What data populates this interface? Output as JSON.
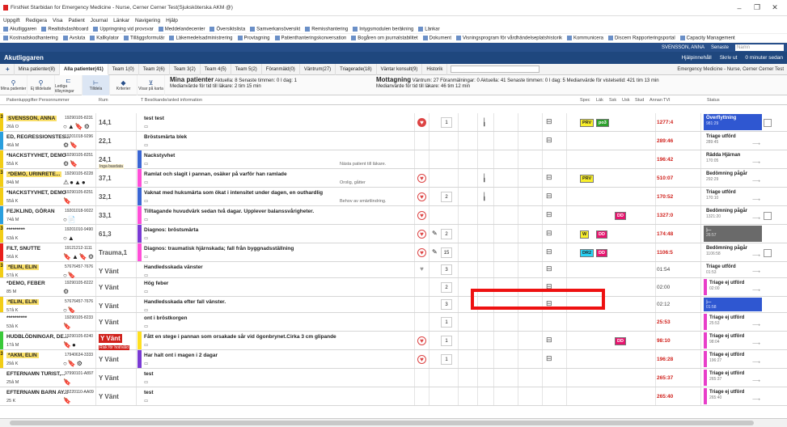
{
  "window": {
    "title": "FirstNet Starbidan for Emergency Medicine - Nurse, Cerner Cerner Test(Sjuksköterska AKM @)",
    "min": "–",
    "restore": "❐",
    "close": "✕"
  },
  "menu": [
    "Uppgift",
    "Redigera",
    "Visa",
    "Patient",
    "Journal",
    "Länkar",
    "Navigering",
    "Hjälp"
  ],
  "bookmarks1": [
    "Akutliggaren",
    "Realtidsdashboard",
    "Uppringning vid provsvar",
    "Meddelandecenter",
    "Översiktslista",
    "Samverkansöversikt",
    "Remisshantering",
    "Intygsmodulen beräkning",
    "Länkar"
  ],
  "bookmarks2": [
    "Kostnadskodhantering",
    "Avsluta",
    "Kallkylator",
    "Tilläggsformulär",
    "Läkemedelsadministrering",
    "Provtagning",
    "Patienthanteringskonversation",
    "Bogåren om journalstabilitet",
    "Dokument",
    "Visningsprogram för vårdhändelseplatshistorik",
    "Kommunicera",
    "Discern Rapporteringsportal",
    "Capacity Management"
  ],
  "userbar": {
    "user": "SVENSSON, ANNA",
    "role": "Senaste",
    "search_placeholder": "Namn"
  },
  "appbar": {
    "title": "Akutliggaren",
    "help": "Hjälpinnehåll",
    "print": "Skriv ut",
    "refresh": "0 minuter sedan"
  },
  "tabs": [
    "+",
    "Mina patienter(8)",
    "Alla patienter(41)",
    "Team 1(0)",
    "Team 2(6)",
    "Team 3(2)",
    "Team 4(5)",
    "Team 5(2)",
    "Föranmäld(0)",
    "Väntrum(27)",
    "Triagerade(18)",
    "Väntar konsult(9)",
    "Historik"
  ],
  "tabs_context": "Emergency Medicine - Nurse, Cerner Cerner Test",
  "toolbar": {
    "buttons": [
      "Mina patienter",
      "Ej tilldelade",
      "Lediga tillsyningar",
      "Tilldela",
      "Kriterier",
      "Visar på karta"
    ],
    "mp_title": "Mina patienter",
    "mp_text": "Aktuella: 8  Senaste timmen: 0  I dag: 1",
    "mp_text2": "Medianvärde för tid till läkare: 2 tim 15 min",
    "mot_title": "Mottagning",
    "mot_text": "Väntrum: 27  Föranmälningar: 0  Aktuella: 41  Senaste timmen: 0  I dag: 5  Medianvärde för vistelsetid: 421 tim 13 min",
    "mot_text2": "Medianvärde för tid till läkare: 46 tim 12 min"
  },
  "columns": {
    "patient": "Patientuppgifter  Personnummer",
    "room": "Rum",
    "info": "T  Besökande/anled information",
    "spec": "Spec",
    "lak": "Läk",
    "ssk": "Ssk",
    "usk": "Usk",
    "stud": "Stud",
    "annan": "Annan",
    "tvi": "TVI",
    "status": "Status"
  },
  "rows": [
    {
      "prio": "3",
      "stripe": "#f2cd16",
      "name": "SVENSSON, ANNA",
      "hl": true,
      "pid": "19290105-8231",
      "age": "26å O",
      "room": "14,1",
      "pcolor": "#ffffff",
      "info": "test test",
      "info2": "",
      "note": "",
      "heart": "fill",
      "num": "1",
      "tags": [
        [
          "PRV",
          "#f9ef2a"
        ],
        [
          "po3",
          "#2ca02c"
        ]
      ],
      "tvi": "1277:4",
      "tvic": "red",
      "st": "Överflyttning",
      "st2": "981:29",
      "stc": "blue",
      "icons": "○▲🔖⚙"
    },
    {
      "prio": "",
      "stripe": "#2a9fde",
      "name": "ED, REGRESSIONSTES...",
      "hl": false,
      "pid": "19201018-9296",
      "age": "46å M",
      "room": "22,1",
      "pcolor": "#ffffff",
      "info": "Bröstsmärta blek",
      "info2": "",
      "note": "",
      "heart": "",
      "num": "",
      "tags": [],
      "tvi": "289:46",
      "tvic": "red",
      "st": "Triage utförd",
      "st2": "289:45",
      "stc": "arrow",
      "icons": "⚙🔖"
    },
    {
      "prio": "",
      "stripe": "#f2cd16",
      "name": "*NACKSTYVHET, DEMO",
      "hl": false,
      "pid": "19290105-8251",
      "age": "55å K",
      "room": "24,1",
      "pcolor": "#3a66d4",
      "info": "Nackstyvhet",
      "info2": "",
      "note": "Nästa patient till läkare.",
      "heart": "",
      "num": "",
      "tags": [],
      "tvi": "196:42",
      "tvic": "red",
      "st": "Rädda Hjärnan",
      "st2": "170:05",
      "stc": "arrow",
      "icons": "⚙🔖",
      "roomsub": "Inga basdata"
    },
    {
      "prio": "3",
      "stripe": "#f2cd16",
      "name": "*DEMO, URINRETE...",
      "hl": true,
      "pid": "19290105-8228",
      "age": "84å M",
      "room": "37,1",
      "pcolor": "#ff4fd8",
      "info": "Ramlat och slagit i pannan, osäker på varför han ramlade",
      "info2": "",
      "note": "Orolig, gåtter",
      "heart": "o",
      "num": "",
      "tags": [
        [
          "PRV",
          "#f9ef2a"
        ]
      ],
      "tvi": "510:07",
      "tvic": "red",
      "st": "Bedömning pågår",
      "st2": "292:29",
      "stc": "arrow",
      "icons": "⚠●▲●"
    },
    {
      "prio": "",
      "stripe": "#f2cd16",
      "name": "*NACKSTYVHET, DEMO",
      "hl": false,
      "pid": "19290105-8251",
      "age": "55å K",
      "room": "32,1",
      "pcolor": "#3a66d4",
      "info": "Vaknat med huksmärta som ökat i intensitet under dagen, en outhardlig",
      "info2": "",
      "note": "Behov av smärtlindring.",
      "heart": "o",
      "num": "2",
      "tags": [],
      "tvi": "170:52",
      "tvic": "red",
      "st": "Triage utförd",
      "st2": "170:10",
      "stc": "arrow",
      "icons": "🔖"
    },
    {
      "prio": "",
      "stripe": "#2a9fde",
      "name": "FEJKLIND, GÖRAN",
      "hl": false,
      "pid": "19201018-9022",
      "age": "74å M",
      "room": "33,1",
      "pcolor": "#ff4fd8",
      "info": "Tilltagande huvudvärk sedan två dagar. Upplever balanssvårigheter.",
      "info2": "",
      "note": "",
      "heart": "o",
      "num": "",
      "tags": [
        [
          "DD",
          "#e7146e"
        ]
      ],
      "tvi": "1327:0",
      "tvic": "red",
      "st": "Bedömning pågår",
      "st2": "1321:20",
      "stc": "arrow",
      "icons": "○📄"
    },
    {
      "prio": "3",
      "stripe": "#f2cd16",
      "name": "*********",
      "hl": false,
      "pid": "19201010-9490",
      "age": "63å K",
      "room": "61,3",
      "pcolor": "#7a3ad4",
      "info": "Diagnos: bröstsmärta",
      "info2": "",
      "note": "",
      "heart": "o",
      "num": "2",
      "tags": [
        [
          "W",
          "#f9ef2a"
        ],
        [
          "DD",
          "#e7146e"
        ]
      ],
      "tvi": "174:48",
      "tvic": "red",
      "st": "",
      "st2": "26:57",
      "stc": "gray",
      "icons": "○▲"
    },
    {
      "prio": "",
      "stripe": "#e8201b",
      "name": "FILT, SNUTTE",
      "hl": false,
      "pid": "19121212-1111",
      "age": "56å K",
      "room": "Trauma,1",
      "pcolor": "#ff4fd8",
      "info": "Diagnos: traumatisk hjärnskada; fall från byggnadsställning",
      "info2": "",
      "note": "",
      "heart": "o",
      "num": "15",
      "tags": [
        [
          "DR2",
          "#2ad3f5"
        ],
        [
          "DD",
          "#e7146e"
        ]
      ],
      "tvi": "1106:5",
      "tvic": "red",
      "st": "Bedömning pågår",
      "st2": "1106:58",
      "stc": "arrow",
      "icons": "🔖▲🔖⚙"
    },
    {
      "prio": "3",
      "stripe": "#f2cd16",
      "name": "*ELIN, ELIN",
      "hl": true,
      "pid": "57676457-7676",
      "age": "57å K",
      "room": "Y Vänt",
      "pcolor": "#ffffff",
      "info": "Handledsskada vänster",
      "info2": "",
      "note": "",
      "heart": "gray",
      "num": "3",
      "tags": [],
      "tvi": "01:54",
      "tvic": "gray",
      "st": "Triage utförd",
      "st2": "01:53",
      "stc": "arrow",
      "icons": "○🔖"
    },
    {
      "prio": "",
      "stripe": "#ffffff",
      "name": "*DEMO, FEBER",
      "hl": false,
      "pid": "19290105-8222",
      "age": "85 M",
      "room": "Y Vänt",
      "pcolor": "#ffffff",
      "info": "Hög feber",
      "info2": "",
      "note": "",
      "heart": "",
      "num": "2",
      "tags": [],
      "tvi": "02:00",
      "tvic": "gray",
      "st": "Triage ej utförd",
      "st2": "02:00",
      "stc": "pink",
      "icons": "⚙"
    },
    {
      "prio": "",
      "stripe": "#f2cd16",
      "name": "*ELIN, ELIN",
      "hl": true,
      "pid": "57676457-7676",
      "age": "57å K",
      "room": "Y Vänt",
      "pcolor": "#ffffff",
      "info": "Handledsskada efter fall vänster.",
      "info2": "",
      "note": "",
      "heart": "",
      "num": "3",
      "tags": [],
      "tvi": "02:12",
      "tvic": "gray",
      "st": "",
      "st2": "01:58",
      "stc": "blue",
      "icons": "○🔖"
    },
    {
      "prio": "",
      "stripe": "#ffffff",
      "name": "**********",
      "hl": false,
      "pid": "19290105-8233",
      "age": "53å K",
      "room": "Y Vänt",
      "pcolor": "#ffffff",
      "info": "ont i bröstkorgen",
      "info2": "",
      "note": "",
      "heart": "",
      "num": "1",
      "tags": [],
      "tvi": "25:53",
      "tvic": "red",
      "st": "Triage ej utförd",
      "st2": "25:53",
      "stc": "pink",
      "icons": "🔖"
    },
    {
      "prio": "",
      "stripe": "#3ac93a",
      "name": "HUDBLÖDNINGAR, DE...",
      "hl": false,
      "pid": "19290105-8240",
      "age": "17å M",
      "room": "Y Vänt",
      "pcolor": "#ffe020",
      "info": "Fått en stege i pannan som orsakade sår vid ögonbrynet.Cirka 3 cm glipande",
      "info2": "",
      "note": "",
      "heart": "o",
      "num": "1",
      "tags": [
        [
          "DD",
          "#e7146e"
        ]
      ],
      "tvi": "98:10",
      "tvic": "red",
      "st": "Triage ej utförd",
      "st2": "98:04",
      "stc": "pink",
      "icons": "🔖●",
      "roomred": true,
      "roomsub": "Risk för hot/våld"
    },
    {
      "prio": "3",
      "stripe": "#f2cd16",
      "name": "*AKM, ELIN",
      "hl": true,
      "pid": "17940634-3333",
      "age": "29å K",
      "room": "Y Vänt",
      "pcolor": "#7a3ad4",
      "info": "Har halt ont i magen i 2 dagar",
      "info2": "",
      "note": "",
      "heart": "o",
      "num": "1",
      "tags": [],
      "tvi": "196:28",
      "tvic": "red",
      "st": "Triage ej utförd",
      "st2": "196:27",
      "stc": "pink",
      "icons": "○🔖⚙"
    },
    {
      "prio": "",
      "stripe": "#ffffff",
      "name": "EFTERNAMN TURIST,...",
      "hl": false,
      "pid": "97990101-A897",
      "age": "25å M",
      "room": "Y Vänt",
      "pcolor": "#ffffff",
      "info": "test",
      "info2": "",
      "note": "",
      "heart": "",
      "num": "",
      "tags": [],
      "tvi": "265:37",
      "tvic": "red",
      "st": "Triage ej utförd",
      "st2": "265:37",
      "stc": "pink",
      "icons": "🔖"
    },
    {
      "prio": "",
      "stripe": "#ffffff",
      "name": "EFTERNAMN BARN AY...",
      "hl": false,
      "pid": "98220110-AA09",
      "age": "25 K",
      "room": "Y Vänt",
      "pcolor": "#ffffff",
      "info": "test",
      "info2": "",
      "note": "",
      "heart": "",
      "num": "",
      "tags": [],
      "tvi": "265:40",
      "tvic": "red",
      "st": "Triage ej utförd",
      "st2": "265:40",
      "stc": "pink",
      "icons": "🔖"
    }
  ],
  "highlight": "red-selection-box"
}
